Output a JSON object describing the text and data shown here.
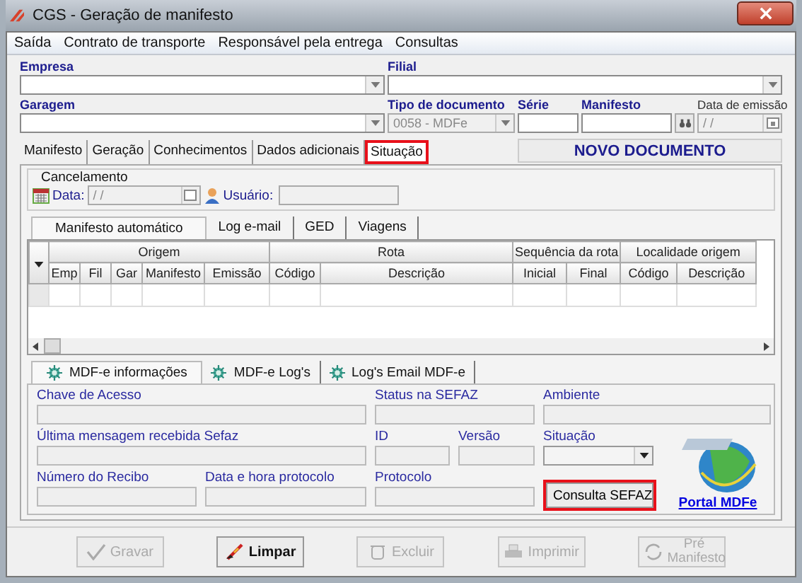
{
  "window": {
    "title": "CGS - Geração de manifesto"
  },
  "menu": [
    "Saída",
    "Contrato de transporte",
    "Responsável pela entrega",
    "Consultas"
  ],
  "header_fields": [
    {
      "label": "Empresa",
      "kind": "dropdown",
      "disabled": false
    },
    {
      "label": "Filial",
      "kind": "dropdown",
      "disabled": false
    },
    {
      "label": "Garagem",
      "kind": "dropdown",
      "disabled": false
    },
    {
      "label": "Tipo de documento",
      "kind": "dropdown",
      "disabled": true,
      "value": "0058 - MDFe"
    },
    {
      "label": "Série",
      "kind": "text",
      "disabled": false
    },
    {
      "label": "Manifesto",
      "kind": "search",
      "disabled": false
    },
    {
      "label": "Data de emissão",
      "kind": "date",
      "disabled": true,
      "value": "/ /"
    }
  ],
  "tabs": [
    {
      "label": "Manifesto",
      "selected": false,
      "highlighted": false
    },
    {
      "label": "Geração",
      "selected": false,
      "highlighted": false
    },
    {
      "label": "Conhecimentos",
      "selected": false,
      "highlighted": false
    },
    {
      "label": "Dados adicionais",
      "selected": false,
      "highlighted": false
    },
    {
      "label": "Situação",
      "selected": true,
      "highlighted": true
    }
  ],
  "status_banner": "NOVO DOCUMENTO",
  "cancelamento": {
    "title": "Cancelamento",
    "date_label": "Data:",
    "date_value": "/ /",
    "user_label": "Usuário:"
  },
  "inner_tabs": [
    {
      "label": "Manifesto automático",
      "selected": true
    },
    {
      "label": "Log e-mail",
      "selected": false
    },
    {
      "label": "GED",
      "selected": false
    },
    {
      "label": "Viagens",
      "selected": false
    }
  ],
  "table": {
    "groups": [
      {
        "label": "Origem"
      },
      {
        "label": "Rota"
      },
      {
        "label": "Sequência da rota"
      },
      {
        "label": "Localidade origem"
      }
    ],
    "columns": [
      "Emp",
      "Fil",
      "Gar",
      "Manifesto",
      "Emissão",
      "Código",
      "Descrição",
      "Inicial",
      "Final",
      "Código",
      "Descrição"
    ]
  },
  "sub_tabs": [
    {
      "label": "MDF-e informações",
      "selected": true
    },
    {
      "label": "MDF-e Log's",
      "selected": false
    },
    {
      "label": "Log's Email MDF-e",
      "selected": false
    }
  ],
  "info_fields": [
    {
      "label": "Chave de Acesso",
      "kind": "text"
    },
    {
      "label": "Status na SEFAZ",
      "kind": "text"
    },
    {
      "label": "Ambiente",
      "kind": "text"
    },
    {
      "label": "Última mensagem recebida Sefaz",
      "kind": "text"
    },
    {
      "label": "ID",
      "kind": "text"
    },
    {
      "label": "Versão",
      "kind": "text"
    },
    {
      "label": "Situação",
      "kind": "dropdown"
    },
    {
      "label": "Número do Recibo",
      "kind": "text"
    },
    {
      "label": "Data e hora protocolo",
      "kind": "text"
    },
    {
      "label": "Protocolo",
      "kind": "text"
    }
  ],
  "consulta_button": {
    "label": "Consulta SEFAZ",
    "highlighted": true
  },
  "portal_link": "Portal MDFe",
  "buttons": [
    {
      "label": "Gravar",
      "disabled": true,
      "kind": "save"
    },
    {
      "label": "Limpar",
      "disabled": false,
      "kind": "clear"
    },
    {
      "label": "Excluir",
      "disabled": true,
      "kind": "delete"
    },
    {
      "label": "Imprimir",
      "disabled": true,
      "kind": "print"
    },
    {
      "label": "Pré Manifesto",
      "disabled": true,
      "kind": "pre"
    }
  ]
}
